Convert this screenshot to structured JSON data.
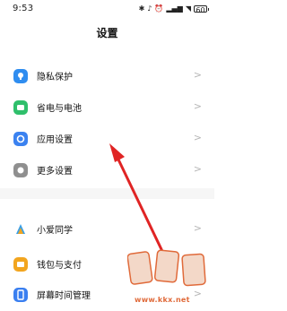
{
  "status_bar": {
    "time": "9:53",
    "battery": "60"
  },
  "page": {
    "title": "设置"
  },
  "settings_items": [
    {
      "label": "隐私保护",
      "icon": "privacy-icon",
      "color": "#2f8df0"
    },
    {
      "label": "省电与电池",
      "icon": "battery-icon",
      "color": "#2fbf6b"
    },
    {
      "label": "应用设置",
      "icon": "app-settings-icon",
      "color": "#3b82f0"
    },
    {
      "label": "更多设置",
      "icon": "more-settings-icon",
      "color": "#8f8f8f"
    },
    {
      "label": "小爱同学",
      "icon": "xiaoai-icon",
      "color": "#3aa0e8"
    },
    {
      "label": "钱包与支付",
      "icon": "wallet-icon",
      "color": "#f2a51f"
    },
    {
      "label": "屏幕时间管理",
      "icon": "screen-time-icon",
      "color": "#3a7ff0"
    }
  ],
  "chevron": ">",
  "annotation": {
    "color": "#e02424"
  },
  "watermark": {
    "url": "www.kkx.net",
    "color": "#e06a3a"
  }
}
